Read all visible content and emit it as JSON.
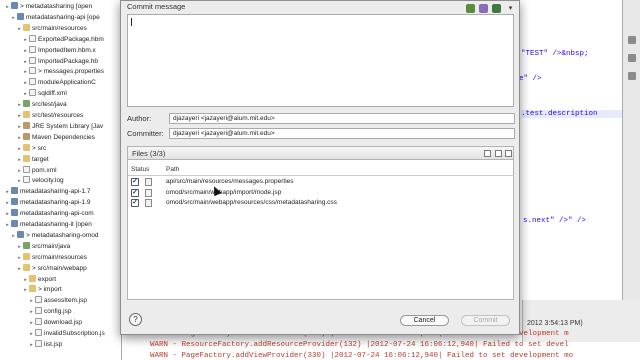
{
  "tree": {
    "items": [
      {
        "label": "> metadatasharing [open",
        "icon": "project-icon",
        "selected": false
      },
      {
        "label": "metadatasharing-api [ope",
        "icon": "project-icon",
        "selected": false
      },
      {
        "label": "src/main/resources",
        "icon": "folder-icon",
        "selected": false
      },
      {
        "label": "ExportedPackage.hbm",
        "icon": "file-icon",
        "selected": false
      },
      {
        "label": "ImportedItem.hbm.x",
        "icon": "file-icon",
        "selected": false
      },
      {
        "label": "ImportedPackage.hb",
        "icon": "file-icon",
        "selected": false
      },
      {
        "label": "> messages.properties",
        "icon": "file-icon",
        "selected": false
      },
      {
        "label": "moduleApplicationC",
        "icon": "file-icon",
        "selected": false
      },
      {
        "label": "sqldiff.xml",
        "icon": "file-icon",
        "selected": false
      },
      {
        "label": "src/test/java",
        "icon": "java-icon",
        "selected": false
      },
      {
        "label": "src/test/resources",
        "icon": "folder-icon",
        "selected": false
      },
      {
        "label": "JRE System Library [Jav",
        "icon": "library-icon",
        "selected": false
      },
      {
        "label": "Maven Dependencies",
        "icon": "library-icon",
        "selected": false
      },
      {
        "label": "> src",
        "icon": "folder-icon",
        "selected": false
      },
      {
        "label": "target",
        "icon": "folder-icon",
        "selected": false
      },
      {
        "label": "pom.xml",
        "icon": "file-icon",
        "selected": false
      },
      {
        "label": "velocity.log",
        "icon": "file-icon",
        "selected": false
      },
      {
        "label": "metadatasharing-api-1.7",
        "icon": "project-icon",
        "selected": false
      },
      {
        "label": "metadatasharing-api-1.9",
        "icon": "project-icon",
        "selected": false
      },
      {
        "label": "metadatasharing-api-com",
        "icon": "project-icon",
        "selected": false
      },
      {
        "label": "metadatasharing-it [open",
        "icon": "project-icon",
        "selected": false
      },
      {
        "label": "> metadatasharing-omod",
        "icon": "project-icon",
        "selected": false
      },
      {
        "label": "src/main/java",
        "icon": "java-icon",
        "selected": false
      },
      {
        "label": "src/main/resources",
        "icon": "folder-icon",
        "selected": false
      },
      {
        "label": "> src/main/webapp",
        "icon": "folder-icon",
        "selected": false
      },
      {
        "label": "export",
        "icon": "folder-icon",
        "selected": false
      },
      {
        "label": "> import",
        "icon": "folder-icon",
        "selected": false
      },
      {
        "label": "assessItem.jsp",
        "icon": "file-icon",
        "selected": false
      },
      {
        "label": "config.jsp",
        "icon": "file-icon",
        "selected": false
      },
      {
        "label": "download.jsp",
        "icon": "file-icon",
        "selected": false
      },
      {
        "label": "invalidSubscription.js",
        "icon": "file-icon",
        "selected": false
      },
      {
        "label": "list.jsp",
        "icon": "file-icon",
        "selected": false
      }
    ]
  },
  "editor": {
    "lines": [
      "\"TEST\" />&nbsp;",
      "e\" />",
      ".test.description",
      "s.next\" />\" />"
    ]
  },
  "console": {
    "timestamp": "2012 3:54:13 PM)",
    "lines": [
      "WARN - PageFactory.addViewProvider(330) |2012-07-24 16:06:12,940| Failed to set development m",
      "WARN - ResourceFactory.addResourceProvider(132) |2012-07-24 16:06:12,940| Failed to set devel",
      "WARN - PageFactory.addViewProvider(330) |2012-07-24 16:06:12,940| Failed to set development mo"
    ]
  },
  "dialog": {
    "commit_message_label": "Commit message",
    "commit_message_value": "",
    "author_label": "Author:",
    "author_value": "djazayeri <jazayeri@alum.mit.edu>",
    "committer_label": "Committer:",
    "committer_value": "djazayeri <jazayeri@alum.mit.edu>",
    "files_title": "Files (3/3)",
    "col_status": "Status",
    "col_path": "Path",
    "files": [
      {
        "path": "api/src/main/resources/messages.properties",
        "checked": true
      },
      {
        "path": "omod/src/main/webapp/import/mode.jsp",
        "checked": true
      },
      {
        "path": "omod/src/main/webapp/resources/css/metadatasharing.css",
        "checked": true
      }
    ],
    "help_glyph": "?",
    "cancel_label": "Cancel",
    "commit_label": "Commit",
    "check_glyph": "✓"
  }
}
